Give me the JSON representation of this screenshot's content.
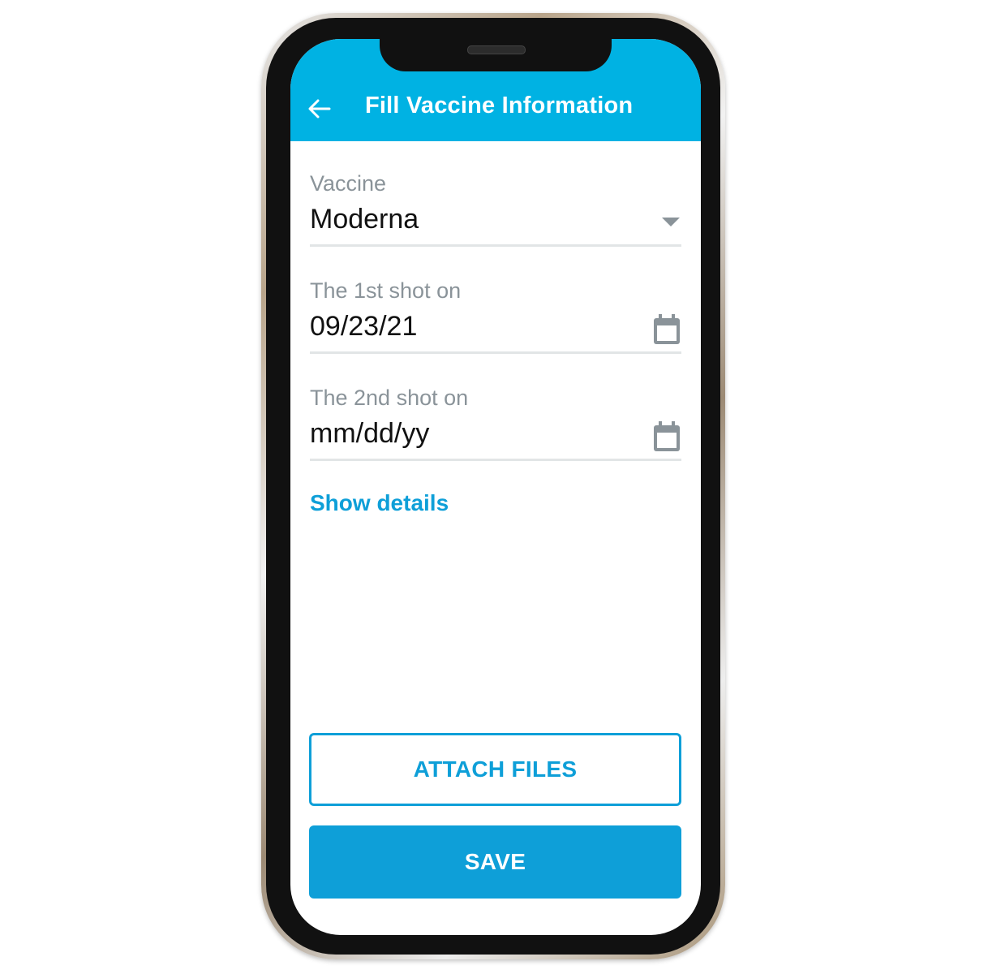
{
  "app": {
    "title": "Fill Vaccine Information",
    "back_icon": "arrow-left-icon",
    "colors": {
      "appbar": "#00b2e3",
      "accent": "#0e9fd8",
      "label": "#8a9399"
    }
  },
  "form": {
    "vaccine": {
      "label": "Vaccine",
      "value": "Moderna",
      "icon": "dropdown-triangle-icon"
    },
    "first_shot": {
      "label": "The 1st shot on",
      "value": "09/23/21",
      "icon": "calendar-icon"
    },
    "second_shot": {
      "label": "The 2nd shot on",
      "value": "mm/dd/yy",
      "icon": "calendar-icon"
    },
    "show_details": "Show details"
  },
  "actions": {
    "attach_files": "ATTACH FILES",
    "save": "SAVE"
  }
}
